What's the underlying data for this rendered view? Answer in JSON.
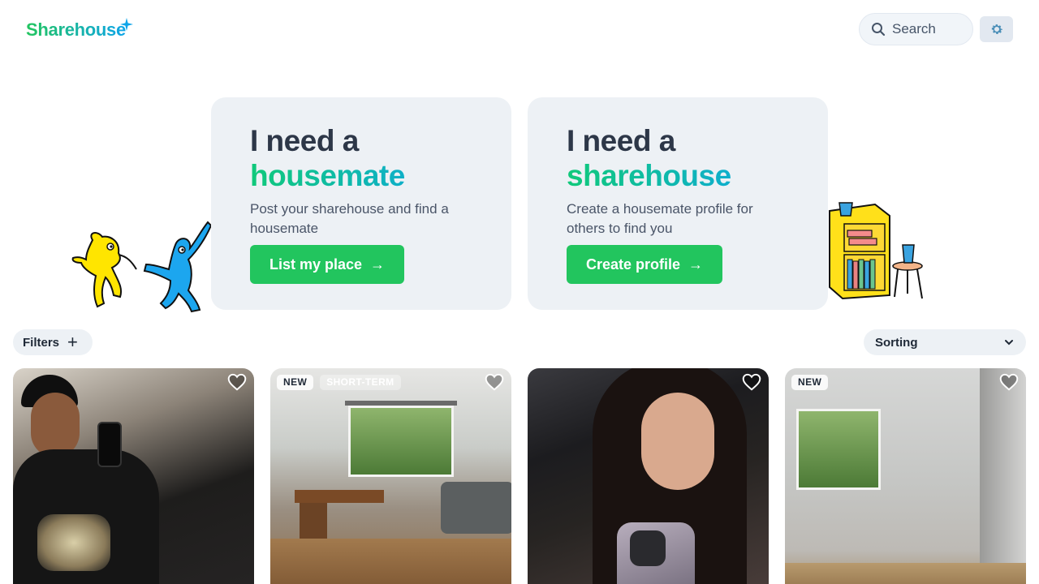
{
  "header": {
    "logo_text": "Sharehouse",
    "search_label": "Search"
  },
  "hero": {
    "left": {
      "title_line1": "I need a",
      "title_line2": "housemate",
      "subtitle": "Post your sharehouse and find a housemate",
      "button_label": "List my place"
    },
    "right": {
      "title_line1": "I need a",
      "title_line2": "sharehouse",
      "subtitle": "Create a housemate profile for others to find you",
      "button_label": "Create profile"
    }
  },
  "toolbar": {
    "filters_label": "Filters",
    "sorting_label": "Sorting"
  },
  "listings": [
    {
      "badges": []
    },
    {
      "badges": [
        "NEW",
        "SHORT-TERM"
      ]
    },
    {
      "badges": []
    },
    {
      "badges": [
        "NEW"
      ]
    }
  ],
  "colors": {
    "brand_green": "#22c55e",
    "brand_blue": "#0ea5e9",
    "card_bg": "#edf1f5"
  }
}
